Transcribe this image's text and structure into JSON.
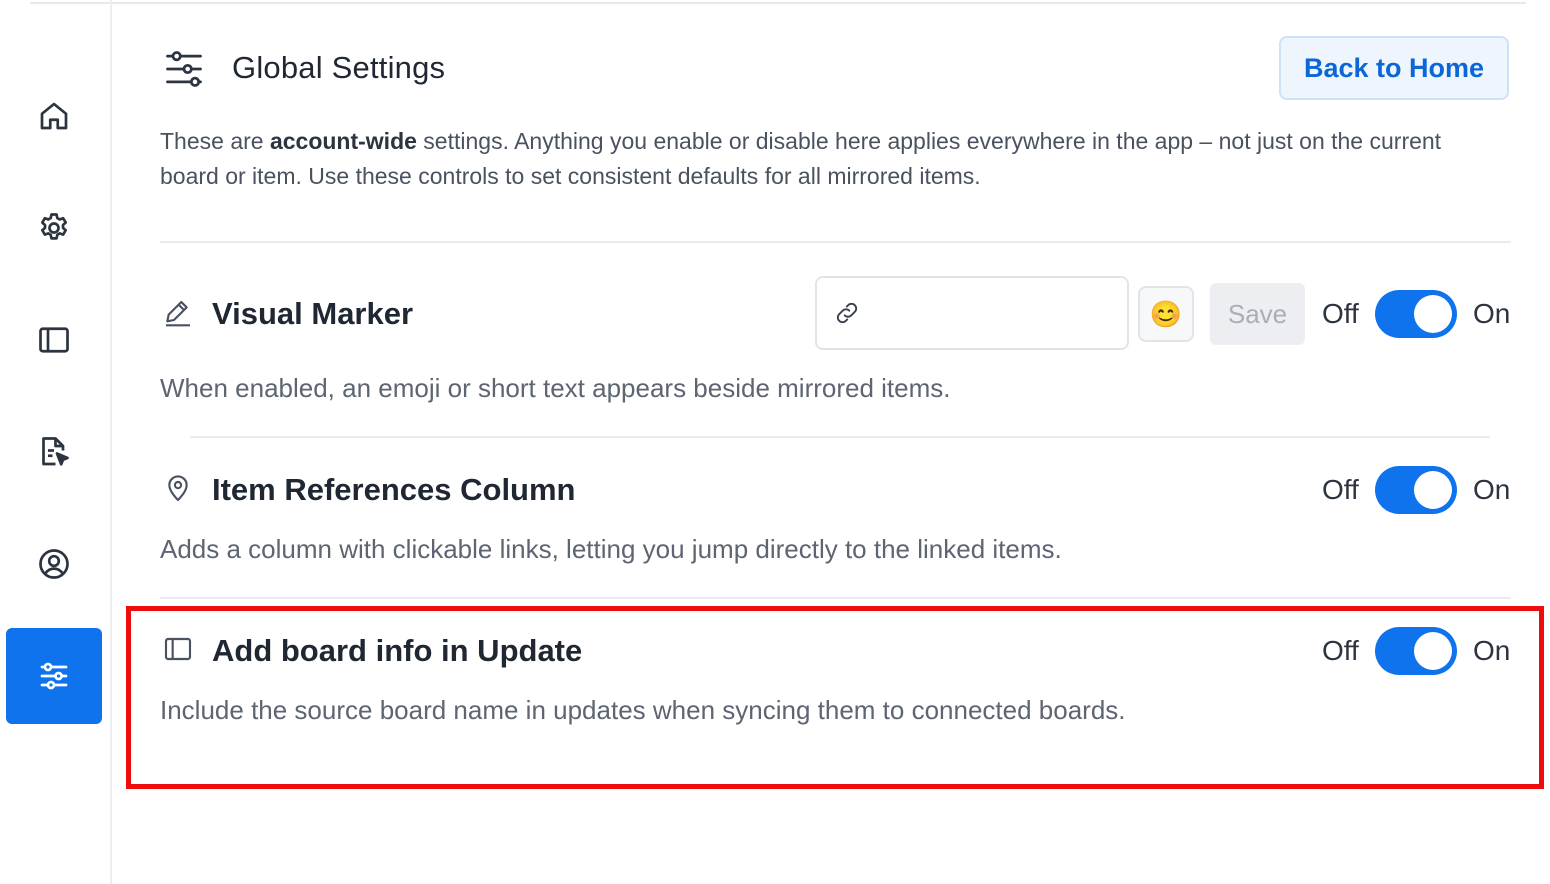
{
  "sidebar": {
    "items": [
      {
        "name": "home",
        "icon": "home-icon",
        "active": false
      },
      {
        "name": "settings",
        "icon": "gear-icon",
        "active": false
      },
      {
        "name": "board",
        "icon": "panel-icon",
        "active": false
      },
      {
        "name": "document",
        "icon": "document-cursor-icon",
        "active": false
      },
      {
        "name": "profile",
        "icon": "user-circle-icon",
        "active": false
      },
      {
        "name": "global-settings",
        "icon": "sliders-icon",
        "active": true
      }
    ]
  },
  "header": {
    "icon": "sliders-icon",
    "title": "Global Settings",
    "back_button": "Back to Home"
  },
  "intro": {
    "prefix": "These are ",
    "bold": "account-wide",
    "suffix": " settings. Anything you enable or disable here applies everywhere in the app – not just on the current board or item. Use these controls to set consistent defaults for all mirrored items."
  },
  "settings": [
    {
      "icon": "pencil-icon",
      "title": "Visual Marker",
      "description": "When enabled, an emoji or short text appears beside mirrored items.",
      "input_icon": "link-icon",
      "input_value": "",
      "emoji": "😊",
      "save_label": "Save",
      "off_label": "Off",
      "on_label": "On",
      "enabled": true
    },
    {
      "icon": "map-pin-icon",
      "title": "Item References Column",
      "description": "Adds a column with clickable links, letting you jump directly to the linked items.",
      "off_label": "Off",
      "on_label": "On",
      "enabled": true
    },
    {
      "icon": "panel-icon",
      "title": "Add board info in Update",
      "description": "Include the source board name in updates when syncing them to connected boards.",
      "off_label": "Off",
      "on_label": "On",
      "enabled": true
    }
  ],
  "colors": {
    "accent": "#0f73ee",
    "highlight": "#ee0d0d"
  }
}
